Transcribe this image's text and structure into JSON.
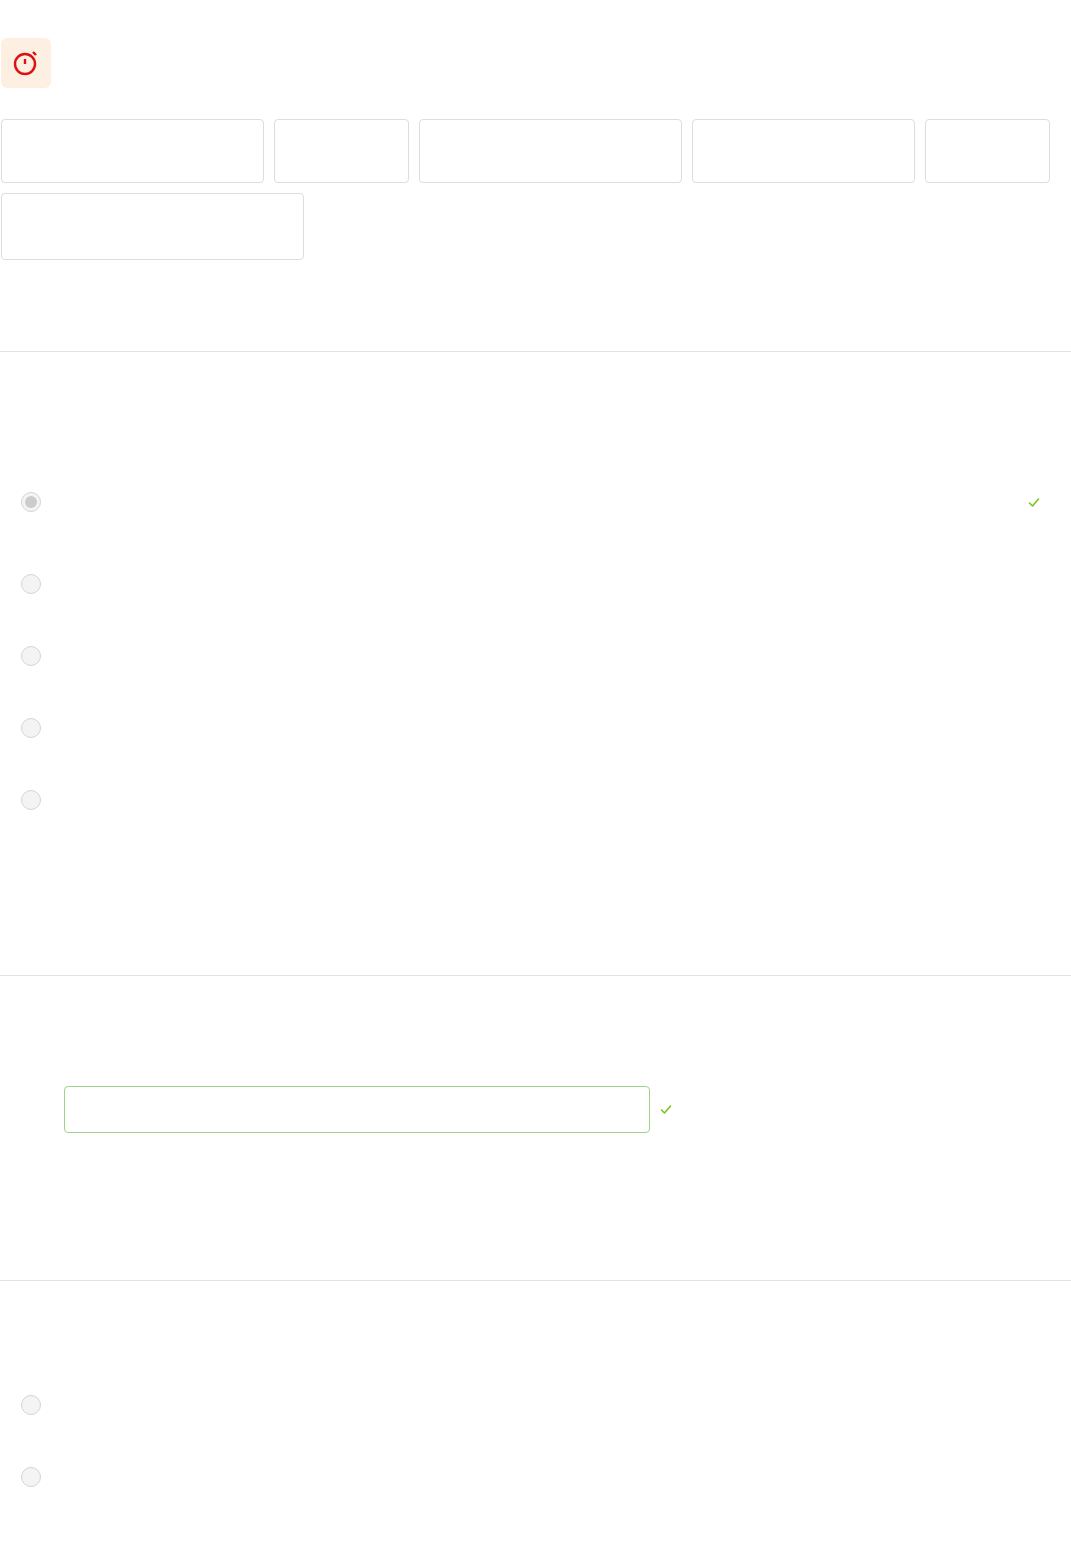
{
  "header": {
    "timer_icon": {
      "alert": true
    }
  },
  "tiles": [
    {
      "kind": "wide"
    },
    {
      "kind": "narrow"
    },
    {
      "kind": "wide"
    },
    {
      "kind": "medium"
    },
    {
      "kind": "small"
    },
    {
      "kind": "large"
    }
  ],
  "question_1": {
    "options": [
      {
        "selected": true,
        "correct": true
      },
      {
        "selected": false,
        "correct": false
      },
      {
        "selected": false,
        "correct": false
      },
      {
        "selected": false,
        "correct": false
      },
      {
        "selected": false,
        "correct": false
      }
    ]
  },
  "question_2": {
    "answer_field": {
      "valid": true
    }
  },
  "question_3": {
    "options": [
      {
        "selected": false,
        "correct": false
      },
      {
        "selected": false,
        "correct": false
      }
    ]
  }
}
